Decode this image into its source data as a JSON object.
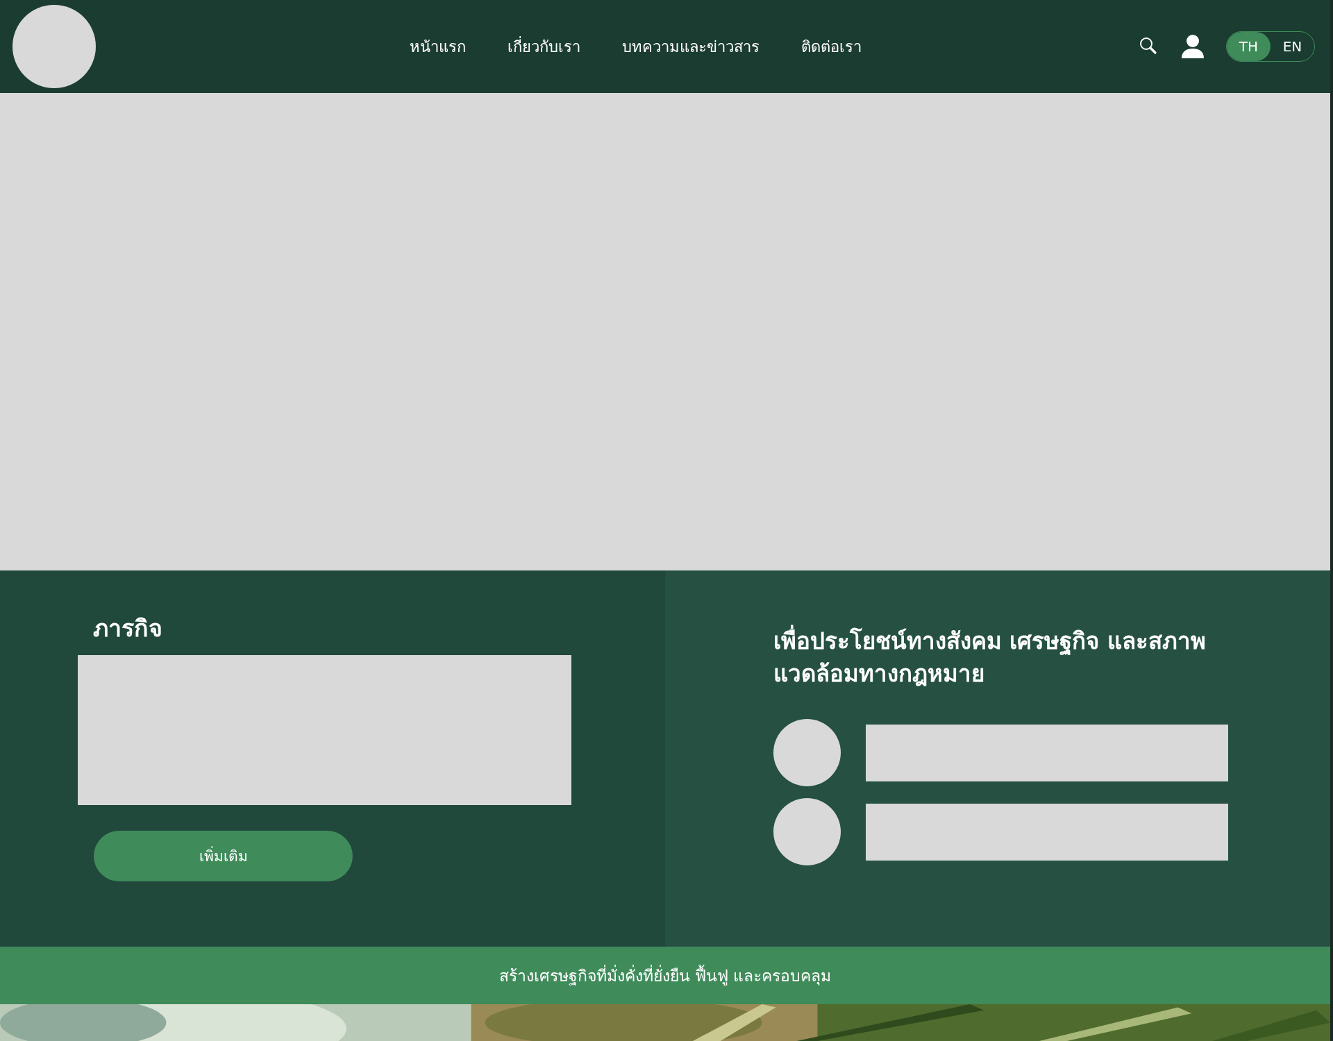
{
  "header": {
    "nav": [
      {
        "label": "หน้าแรก"
      },
      {
        "label": "เกี่ยวกับเรา"
      },
      {
        "label": "บทความและข่าวสาร"
      },
      {
        "label": "ติดต่อเรา"
      }
    ],
    "languages": [
      {
        "label": "TH",
        "selected": true
      },
      {
        "label": "EN",
        "selected": false
      }
    ]
  },
  "mission": {
    "title": "ภารกิจ",
    "button": "เพิ่มเติม"
  },
  "benefits": {
    "title": "เพื่อประโยชน์ทางสังคม เศรษฐกิจ และสภาพแวดล้อมทางกฎหมาย",
    "items": [
      {
        "kind": "placeholder"
      },
      {
        "kind": "placeholder"
      }
    ]
  },
  "banner": {
    "text": "สร้างเศรษฐกิจที่มั่งคั่งที่ยั่งยืน ฟื้นฟู และครอบคลุม"
  }
}
